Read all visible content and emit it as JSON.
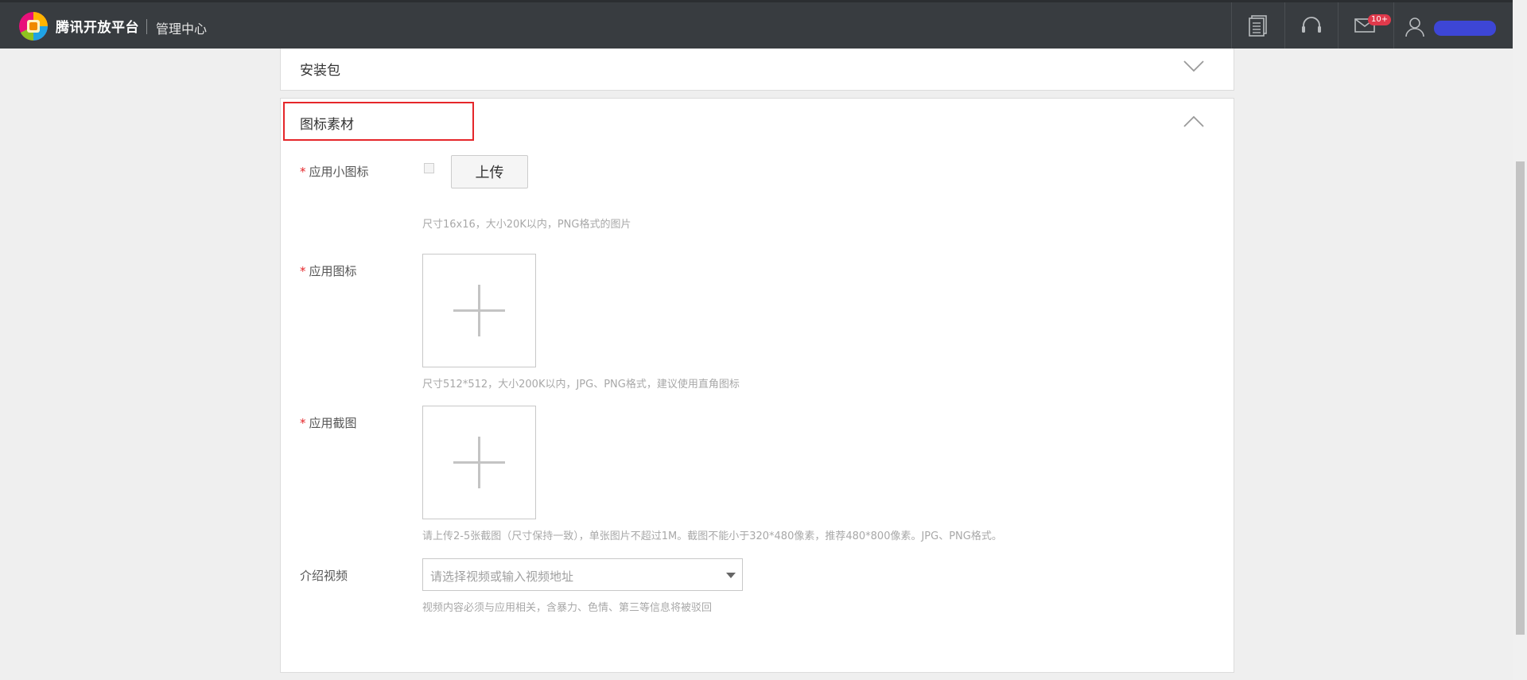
{
  "header": {
    "brand": "腾讯开放平台",
    "section": "管理中心",
    "icons": [
      "document-icon",
      "headset-icon",
      "mail-icon",
      "user-icon"
    ],
    "mail_badge": "10+",
    "colors": {
      "bar": "#383c40",
      "badge": "#e0394b",
      "user_name_redaction": "#3d46d6"
    }
  },
  "panels": {
    "package": {
      "title": "安装包",
      "state": "collapsed"
    },
    "icons": {
      "title": "图标素材",
      "state": "expanded",
      "highlight_color": "#e5262a",
      "fields": {
        "small_icon": {
          "required_mark": "*",
          "label": "应用小图标",
          "button": "上传",
          "hint": "尺寸16x16，大小20K以内，PNG格式的图片"
        },
        "app_icon": {
          "required_mark": "*",
          "label": "应用图标",
          "hint": "尺寸512*512，大小200K以内，JPG、PNG格式，建议使用直角图标"
        },
        "screenshot": {
          "required_mark": "*",
          "label": "应用截图",
          "hint": "请上传2-5张截图（尺寸保持一致），单张图片不超过1M。截图不能小于320*480像素，推荐480*800像素。JPG、PNG格式。"
        },
        "video": {
          "label": "介绍视频",
          "placeholder": "请选择视频或输入视频地址",
          "hint": "视频内容必须与应用相关，含暴力、色情、第三等信息将被驳回"
        }
      }
    }
  }
}
